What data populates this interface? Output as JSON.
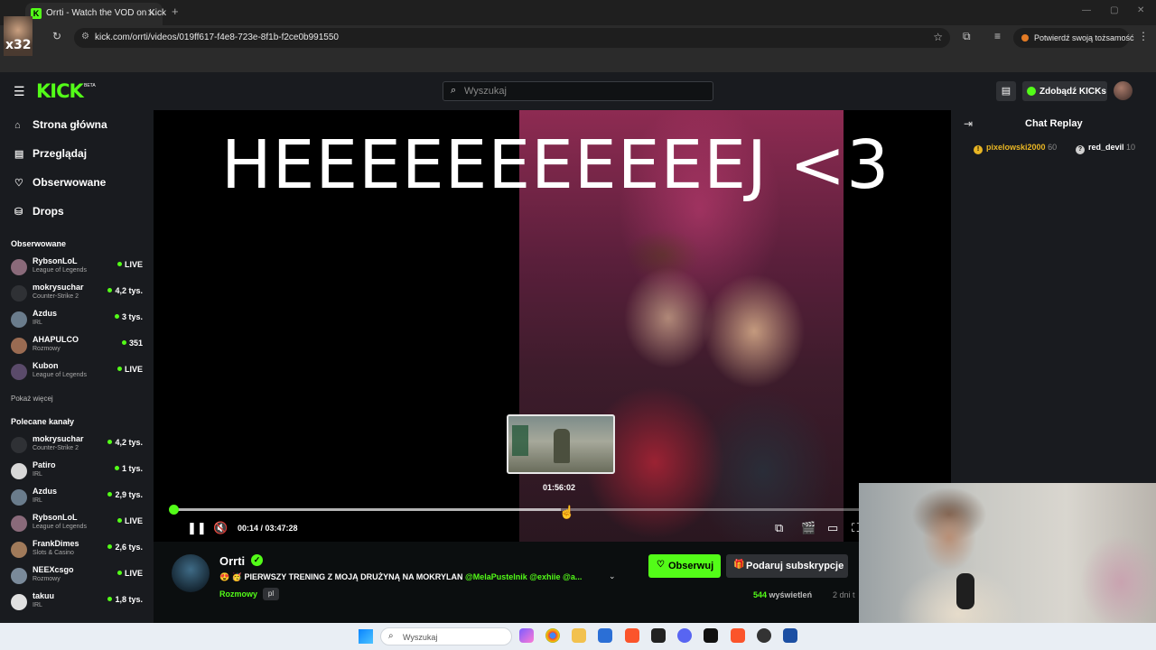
{
  "browser": {
    "tab_title": "Orrti - Watch the VOD on Kick",
    "tab_favicon": "K",
    "tab_close": "✕",
    "new_tab": "+",
    "url": "kick.com/orrti/videos/019ff617-f4e8-723e-8f1b-f2ce0b991550",
    "verify_identity": "Potwierdź swoją tożsamość",
    "corner_label": "x32"
  },
  "kick": {
    "logo": "KICK",
    "logo_badge": "BETA",
    "search_placeholder": "Wyszukaj",
    "get_kicks": "Zdobądź KICKs",
    "accent": "#53fc18"
  },
  "sidebar": {
    "nav": [
      {
        "icon": "home-icon",
        "label": "Strona główna"
      },
      {
        "icon": "browse-icon",
        "label": "Przeglądaj"
      },
      {
        "icon": "heart-icon",
        "label": "Obserwowane"
      },
      {
        "icon": "drops-icon",
        "label": "Drops"
      }
    ],
    "followed_title": "Obserwowane",
    "followed": [
      {
        "name": "RybsonLoL",
        "category": "League of Legends",
        "status": "LIVE"
      },
      {
        "name": "mokrysuchar",
        "category": "Counter-Strike 2",
        "status": "4,2 tys."
      },
      {
        "name": "Azdus",
        "category": "IRL",
        "status": "3 tys."
      },
      {
        "name": "AHAPULCO",
        "category": "Rozmowy",
        "status": "351"
      },
      {
        "name": "Kubon",
        "category": "League of Legends",
        "status": "LIVE"
      }
    ],
    "show_more": "Pokaż więcej",
    "recommended_title": "Polecane kanały",
    "recommended": [
      {
        "name": "mokrysuchar",
        "category": "Counter-Strike 2",
        "status": "4,2 tys."
      },
      {
        "name": "Patiro",
        "category": "IRL",
        "status": "1 tys."
      },
      {
        "name": "Azdus",
        "category": "IRL",
        "status": "2,9 tys."
      },
      {
        "name": "RybsonLoL",
        "category": "League of Legends",
        "status": "LIVE"
      },
      {
        "name": "FrankDimes",
        "category": "Slots & Casino",
        "status": "2,6 tys."
      },
      {
        "name": "NEEXcsgo",
        "category": "Rozmowy",
        "status": "LIVE"
      },
      {
        "name": "takuu",
        "category": "IRL",
        "status": "1,8 tys."
      }
    ]
  },
  "player": {
    "overlay_text": "HEEEEEEEEEEEJ <3",
    "preview_time": "01:56:02",
    "time": "00:14 / 03:47:28",
    "progress": 0.001,
    "hover_position": 0.565
  },
  "chat": {
    "title": "Chat Replay",
    "gifters": [
      {
        "name": "pixelowski2000",
        "count": "60"
      },
      {
        "name": "red_devil",
        "count": "10"
      }
    ]
  },
  "channel": {
    "name": "Orrti",
    "title_emoji": "😍 🥳",
    "title_text": "PIERWSZY TRENING Z MOJĄ DRUŻYNĄ NA MOKRYLAN",
    "title_tags": "@MelaPustelnik @exhiie @a...",
    "category": "Rozmowy",
    "language": "pl",
    "follow": "Obserwuj",
    "subscribe": "Podaruj subskrypcje",
    "views_count": "544",
    "views_label": "wyświetleń",
    "ago": "2 dni t"
  },
  "taskbar": {
    "search_placeholder": "Wyszukaj"
  }
}
